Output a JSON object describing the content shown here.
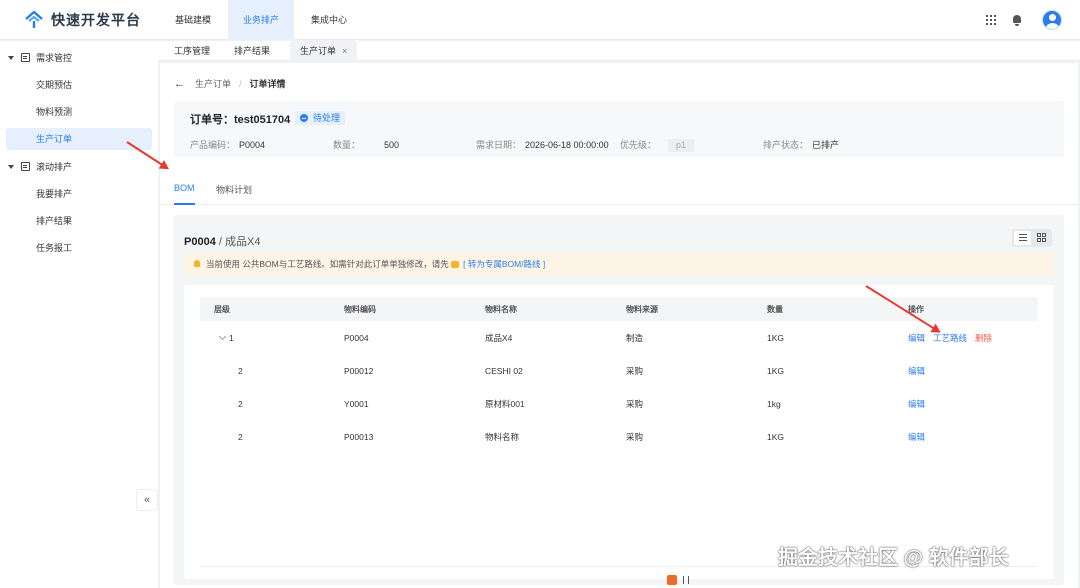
{
  "app": {
    "title": "快速开发平台",
    "brand_color": "#2b7de9",
    "danger_color": "#f05a4a"
  },
  "topnav": [
    {
      "label": "基础建模",
      "active": false
    },
    {
      "label": "业务排产",
      "active": true
    },
    {
      "label": "集成中心",
      "active": false
    }
  ],
  "top_icons": [
    "apps-grid-icon",
    "bell-icon",
    "user-avatar-icon"
  ],
  "sidebar": {
    "groups": [
      {
        "label": "需求管控",
        "icon": "calendar-icon",
        "items": [
          {
            "label": "交期预估",
            "active": false
          },
          {
            "label": "物料预测",
            "active": false
          },
          {
            "label": "生产订单",
            "active": true
          }
        ]
      },
      {
        "label": "滚动排产",
        "icon": "schedule-icon",
        "items": [
          {
            "label": "我要排产",
            "active": false
          },
          {
            "label": "排产结果",
            "active": false
          },
          {
            "label": "任务报工",
            "active": false
          }
        ]
      }
    ],
    "collapse_label": "«"
  },
  "tabs": [
    {
      "label": "工序管理",
      "active": false
    },
    {
      "label": "排产结果",
      "active": false
    },
    {
      "label": "生产订单",
      "active": true,
      "close": "×"
    }
  ],
  "breadcrumb": {
    "back": "←",
    "parent": "生产订单",
    "current": "订单详情"
  },
  "order": {
    "title": "订单号：test051704",
    "status": "待处理",
    "product_code_label": "产品编码：",
    "product_code": "P0004",
    "qty_label": "数量：",
    "qty": "500",
    "date_label": "需求日期：",
    "date": "2026-06-18 00:00:00",
    "priority_label": "优先级：",
    "priority": "p1",
    "sched_label": "排产状态：",
    "sched": "已排产"
  },
  "subtabs": [
    {
      "label": "BOM",
      "active": true
    },
    {
      "label": "物料计划",
      "active": false
    }
  ],
  "bom": {
    "code": "P0004",
    "sep": " / ",
    "name": "成品X4",
    "notice_main": "当前使用 公共BOM与工艺路线。如需针对此订单单独修改，请先",
    "notice_link": "[ 转为专属BOM/路线 ]"
  },
  "table": {
    "headers": [
      "层级",
      "物料编码",
      "物料名称",
      "物料来源",
      "数量",
      "操作"
    ],
    "rows": [
      {
        "level": "1",
        "code": "P0004",
        "name": "成品X4",
        "source": "制造",
        "qty": "1KG",
        "actions": [
          "编辑",
          "工艺路线",
          "删除"
        ]
      },
      {
        "level": "2",
        "code": "P00012",
        "name": "CESHI 02",
        "source": "采购",
        "qty": "1KG",
        "actions": [
          "编辑"
        ]
      },
      {
        "level": "2",
        "code": "Y0001",
        "name": "原材料001",
        "source": "采购",
        "qty": "1kg",
        "actions": [
          "编辑"
        ]
      },
      {
        "level": "2",
        "code": "P00013",
        "name": "物料名称",
        "source": "采购",
        "qty": "1KG",
        "actions": [
          "编辑"
        ]
      }
    ]
  },
  "watermark": "掘金技术社区 @ 软件部长"
}
